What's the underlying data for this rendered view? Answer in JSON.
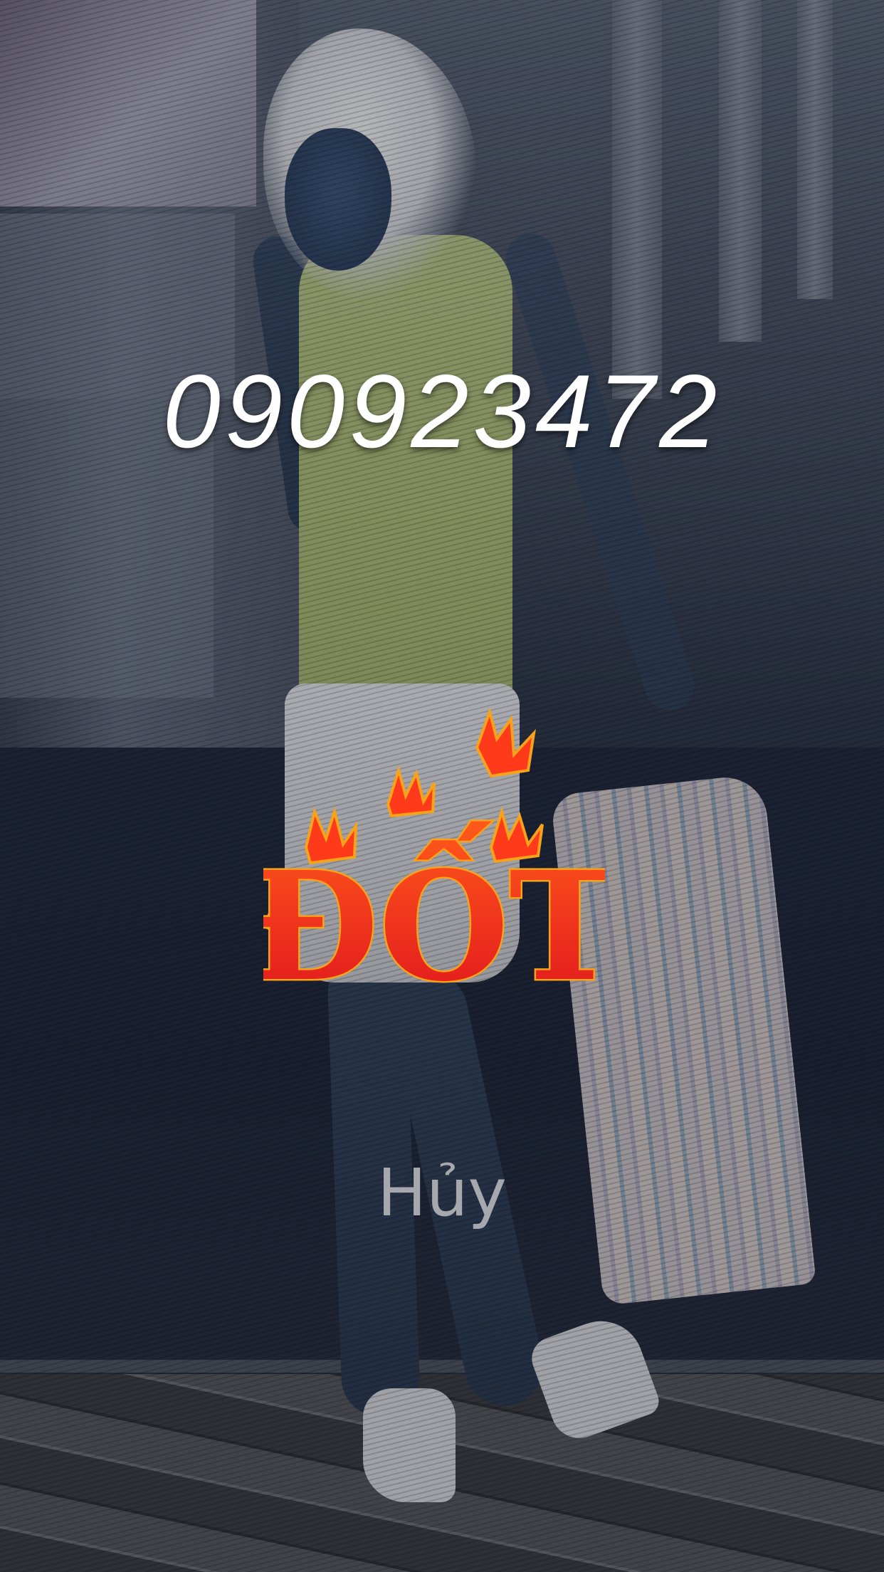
{
  "call_screen": {
    "phone_number": "090923472",
    "burn_button_label": "ĐỐT",
    "cancel_button_label": "Hủy"
  },
  "colors": {
    "phone_number_text": "#ffffff",
    "burn_fill": "#e0141e",
    "burn_flame": "#ff3a1a",
    "burn_outline": "#f6a21a",
    "cancel_text": "#a6a8ad"
  }
}
